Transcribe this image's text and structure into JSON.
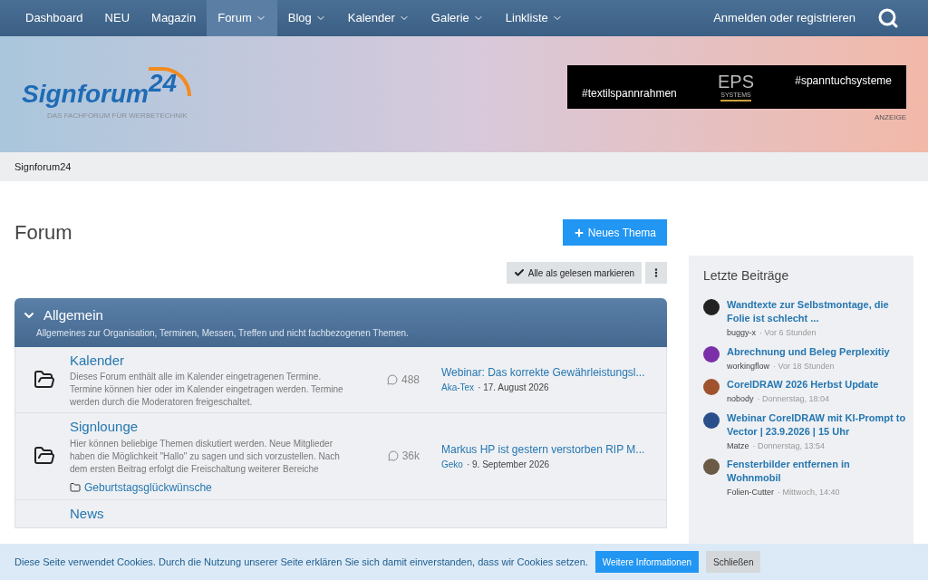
{
  "nav": {
    "items": [
      {
        "label": "Dashboard",
        "dropdown": false,
        "selected": false
      },
      {
        "label": "NEU",
        "dropdown": false,
        "selected": false
      },
      {
        "label": "Magazin",
        "dropdown": false,
        "selected": false
      },
      {
        "label": "Forum",
        "dropdown": true,
        "selected": true
      },
      {
        "label": "Blog",
        "dropdown": true,
        "selected": false
      },
      {
        "label": "Kalender",
        "dropdown": true,
        "selected": false
      },
      {
        "label": "Galerie",
        "dropdown": true,
        "selected": false
      },
      {
        "label": "Linkliste",
        "dropdown": true,
        "selected": false
      }
    ],
    "login": "Anmelden oder registrieren"
  },
  "banner": {
    "logo_word": "Signforum",
    "logo_number": "24",
    "tagline": "DAS FACHFORUM FÜR WERBETECHNIK",
    "ad": {
      "left": "#textilspannrahmen",
      "brand": "EPS",
      "brand_sub": "SYSTEMS",
      "right": "#spanntuchsysteme",
      "label": "ANZEIGE"
    }
  },
  "breadcrumb": "Signforum24",
  "page": {
    "title": "Forum",
    "new_button": "Neues Thema",
    "mark_read": "Alle als gelesen markieren"
  },
  "category": {
    "title": "Allgemein",
    "description": "Allgemeines zur Organisation, Terminen, Messen, Treffen und nicht fachbezogenen Themen.",
    "expanded": true,
    "forums": [
      {
        "title": "Kalender",
        "description": "Dieses Forum enthält alle im Kalender eingetragenen Termine. Termine können hier oder im Kalender eingetragen werden. Termine werden durch die Moderatoren freigeschaltet.",
        "count": "488",
        "last_title": "Webinar: Das korrekte Gewährleistungsl...",
        "last_user": "Aka-Tex",
        "last_date": "· 17. August 2026"
      },
      {
        "title": "Signlounge",
        "description": "Hier können beliebige Themen diskutiert werden. Neue Mitglieder haben die Möglichkeit \"Hallo\" zu sagen und sich vorzustellen. Nach dem ersten Beitrag erfolgt die Freischaltung weiterer Bereiche",
        "count": "36k",
        "last_title": "Markus HP ist gestern verstorben RIP M...",
        "last_user": "Geko",
        "last_date": "· 9. September 2026",
        "subforums": [
          "Geburtstagsglückwünsche"
        ]
      },
      {
        "title": "News"
      }
    ]
  },
  "sidebar": {
    "title": "Letzte Beiträge",
    "posts": [
      {
        "title": "Wandtexte zur Selbstmontage, die Folie ist schlecht ...",
        "user": "buggy-x",
        "time": "· Vor 6 Stunden",
        "color": "#222222"
      },
      {
        "title": "Abrechnung und Beleg Perplexitiy",
        "user": "workingflow",
        "time": "· Vor 18 Stunden",
        "color": "#7b2fa8"
      },
      {
        "title": "CorelDRAW 2026 Herbst Update",
        "user": "nobody",
        "time": "· Donnerstag, 18:04",
        "color": "#a0522d"
      },
      {
        "title": "Webinar CorelDRAW mit KI-Prompt to Vector | 23.9.2026 | 15 Uhr",
        "user": "Matze",
        "time": "· Donnerstag, 13:54",
        "color": "#2a4f8a"
      },
      {
        "title": "Fensterbilder entfernen in Wohnmobil",
        "user": "Folien-Cutter",
        "time": "· Mittwoch, 14:40",
        "color": "#6b5a45"
      }
    ]
  },
  "cookie": {
    "text": "Diese Seite verwendet Cookies. Durch die Nutzung unserer Seite erklären Sie sich damit einverstanden, dass wir Cookies setzen.",
    "more": "Weitere Informationen",
    "close": "Schließen"
  }
}
